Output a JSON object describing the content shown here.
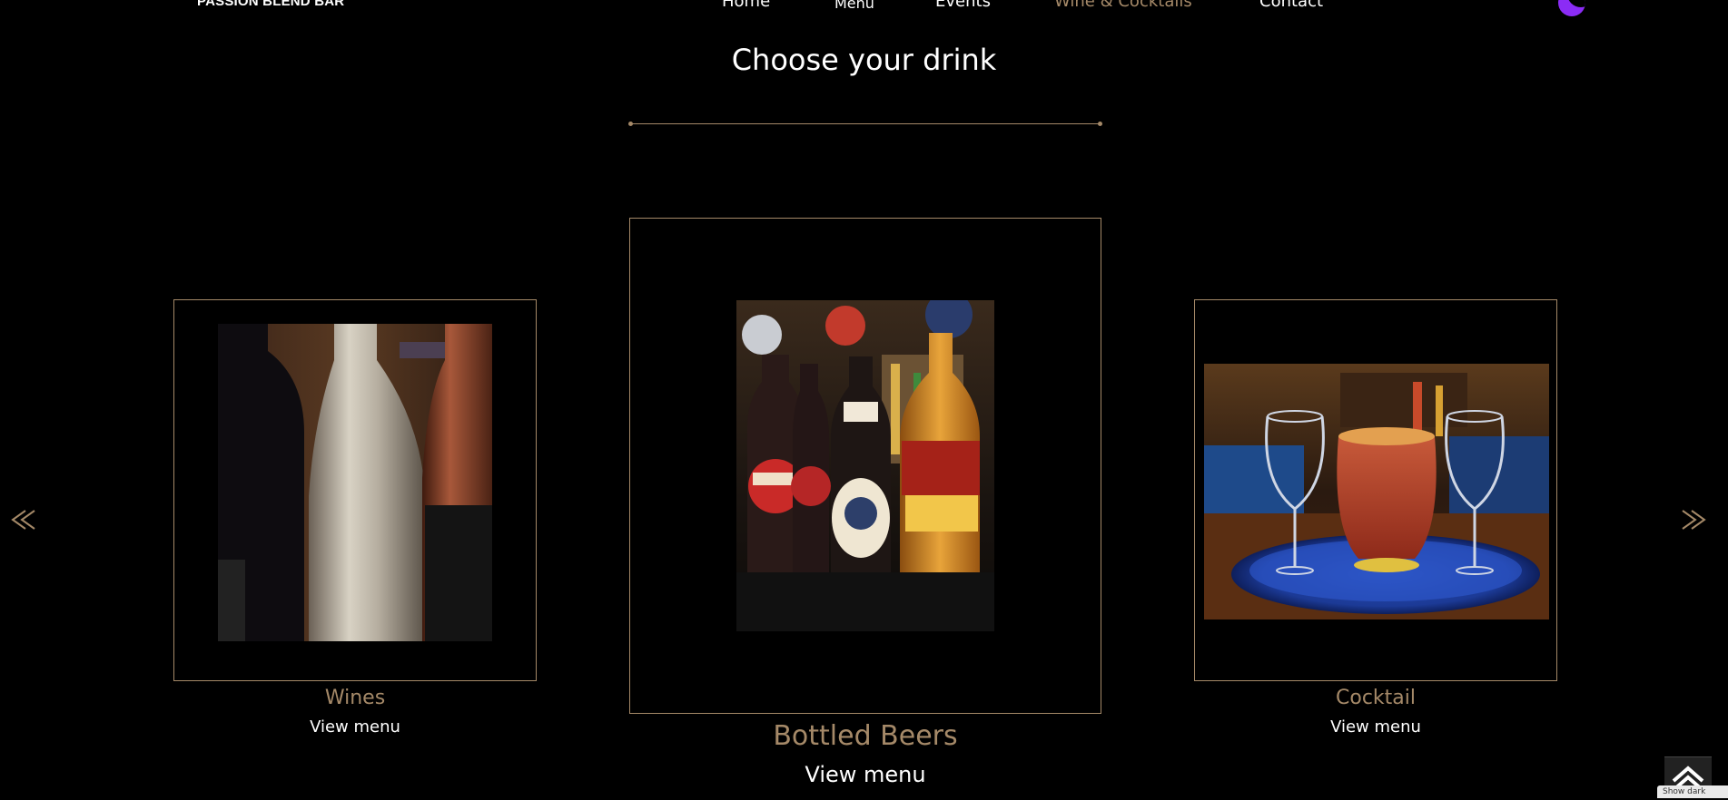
{
  "header": {
    "brand": "PASSION BLEND BAR",
    "nav": [
      {
        "label": "Home",
        "active": false
      },
      {
        "label": "Menu",
        "active": false
      },
      {
        "label": "Events",
        "active": false
      },
      {
        "label": "Wine & Cocktails",
        "active": true
      },
      {
        "label": "Contact",
        "active": false
      }
    ],
    "theme_toggle_icon": "moon-icon"
  },
  "section": {
    "title": "Choose your drink"
  },
  "carousel": {
    "prev_icon": "double-chevron-left-icon",
    "next_icon": "double-chevron-right-icon",
    "cards": [
      {
        "name": "Wines",
        "link": "View menu"
      },
      {
        "name": "Bottled Beers",
        "link": "View menu"
      },
      {
        "name": "Cocktail",
        "link": "View menu"
      }
    ]
  },
  "footer": {
    "back_to_top_icon": "chevron-up-icon",
    "dark_tip": "Show dark"
  },
  "colors": {
    "background": "#000000",
    "accent": "#a58968",
    "moon": "#8b2cf5"
  }
}
